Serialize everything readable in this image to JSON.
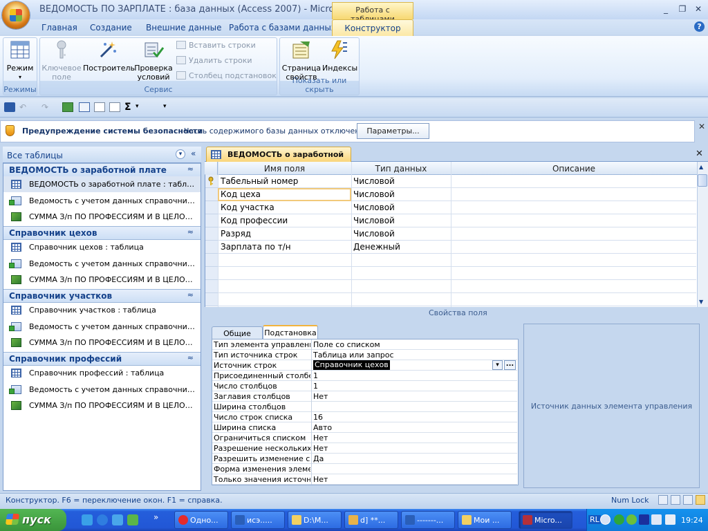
{
  "window": {
    "title": "ВЕДОМОСТЬ ПО ЗАРПЛАТЕ : база данных (Access 2007) - Microso...",
    "context_group": "Работа с таблицами",
    "min": "_",
    "restore": "❐",
    "close": "✕"
  },
  "ribbon_tabs": [
    "Главная",
    "Создание",
    "Внешние данные",
    "Работа с базами данных",
    "Конструктор"
  ],
  "help": "?",
  "ribbon": {
    "views": {
      "label": "Режимы",
      "mode_button": "Режим",
      "mode_arrow": "▾"
    },
    "tools": {
      "label": "Сервис",
      "primary_key": [
        "Ключевое",
        "поле"
      ],
      "builder": "Построитель",
      "test_rules": [
        "Проверка",
        "условий"
      ],
      "insert_rows": "Вставить строки",
      "delete_rows": "Удалить строки",
      "lookup_column": "Столбец  подстановок"
    },
    "show_hide": {
      "label": "Показать или скрыть",
      "property_sheet": [
        "Страница",
        "свойств"
      ],
      "indexes": "Индексы"
    }
  },
  "qat": {
    "sum": "Σ",
    "more": "▾"
  },
  "security": {
    "title": "Предупреждение системы безопасности",
    "message": "Часть содержимого базы данных отключено",
    "button": "Параметры...",
    "close": "✕"
  },
  "nav": {
    "title": "Все таблицы",
    "dropdown": "▾",
    "collapse": "«",
    "groups": [
      {
        "title": "ВЕДОМОСТЬ о заработной плате",
        "items": [
          "ВЕДОМОСТЬ о заработной плате : таблица",
          "Ведомость с учетом данных справочников",
          "СУММА З/п ПО ПРОФЕССИЯМ И В ЦЕЛОМ П..."
        ]
      },
      {
        "title": "Справочник цехов",
        "items": [
          "Справочник цехов : таблица",
          "Ведомость с учетом данных справочников",
          "СУММА З/п ПО ПРОФЕССИЯМ И В ЦЕЛОМ П..."
        ]
      },
      {
        "title": "Справочник участков",
        "items": [
          "Справочник участков : таблица",
          "Ведомость с учетом данных справочников",
          "СУММА З/п ПО ПРОФЕССИЯМ И В ЦЕЛОМ П..."
        ]
      },
      {
        "title": "Справочник профессий",
        "items": [
          "Справочник профессий : таблица",
          "Ведомость с учетом данных справочников",
          "СУММА З/п ПО ПРОФЕССИЯМ И В ЦЕЛОМ П..."
        ]
      }
    ],
    "group_chevron": "≈"
  },
  "document": {
    "tab": "ВЕДОМОСТЬ о заработной плате",
    "close": "✕",
    "columns": [
      "Имя поля",
      "Тип данных",
      "Описание"
    ],
    "rows": [
      {
        "name": "Табельный номер",
        "type": "Числовой"
      },
      {
        "name": "Код цеха",
        "type": "Числовой"
      },
      {
        "name": "Код участка",
        "type": "Числовой"
      },
      {
        "name": "Код профессии",
        "type": "Числовой"
      },
      {
        "name": "Разряд",
        "type": "Числовой"
      },
      {
        "name": "Зарплата по т/н",
        "type": "Денежный"
      }
    ],
    "scroll_up": "▲",
    "scroll_down": "▼"
  },
  "field_props": {
    "caption": "Свойства поля",
    "tabs": [
      "Общие",
      "Подстановка"
    ],
    "rows": [
      {
        "name": "Тип элемента управления",
        "value": "Поле со списком"
      },
      {
        "name": "Тип источника строк",
        "value": "Таблица или запрос"
      },
      {
        "name": "Источник строк",
        "value": "Справочник цехов"
      },
      {
        "name": "Присоединенный столбец",
        "value": "1"
      },
      {
        "name": "Число столбцов",
        "value": "1"
      },
      {
        "name": "Заглавия столбцов",
        "value": "Нет"
      },
      {
        "name": "Ширина столбцов",
        "value": ""
      },
      {
        "name": "Число строк списка",
        "value": "16"
      },
      {
        "name": "Ширина списка",
        "value": "Авто"
      },
      {
        "name": "Ограничиться списком",
        "value": "Нет"
      },
      {
        "name": "Разрешение нескольких значений",
        "value": "Нет"
      },
      {
        "name": "Разрешить изменение списка",
        "value": "Да"
      },
      {
        "name": "Форма изменения элементов",
        "value": ""
      },
      {
        "name": "Только значения источника",
        "value": "Нет"
      }
    ],
    "dropdown_arrow": "▾",
    "builder": "...",
    "help_text": "Источник данных элемента управления"
  },
  "status": {
    "message": "Конструктор.  F6 = переключение окон.  F1 = справка.",
    "numlock": "Num Lock"
  },
  "taskbar": {
    "start": "пуск",
    "tasks": [
      "Одно...",
      "исэ.....",
      "D:\\М...",
      "d] **...",
      "-------...",
      "Мои ...",
      "Micro..."
    ],
    "lang": "RL",
    "clock": "19:24",
    "more": "»"
  }
}
